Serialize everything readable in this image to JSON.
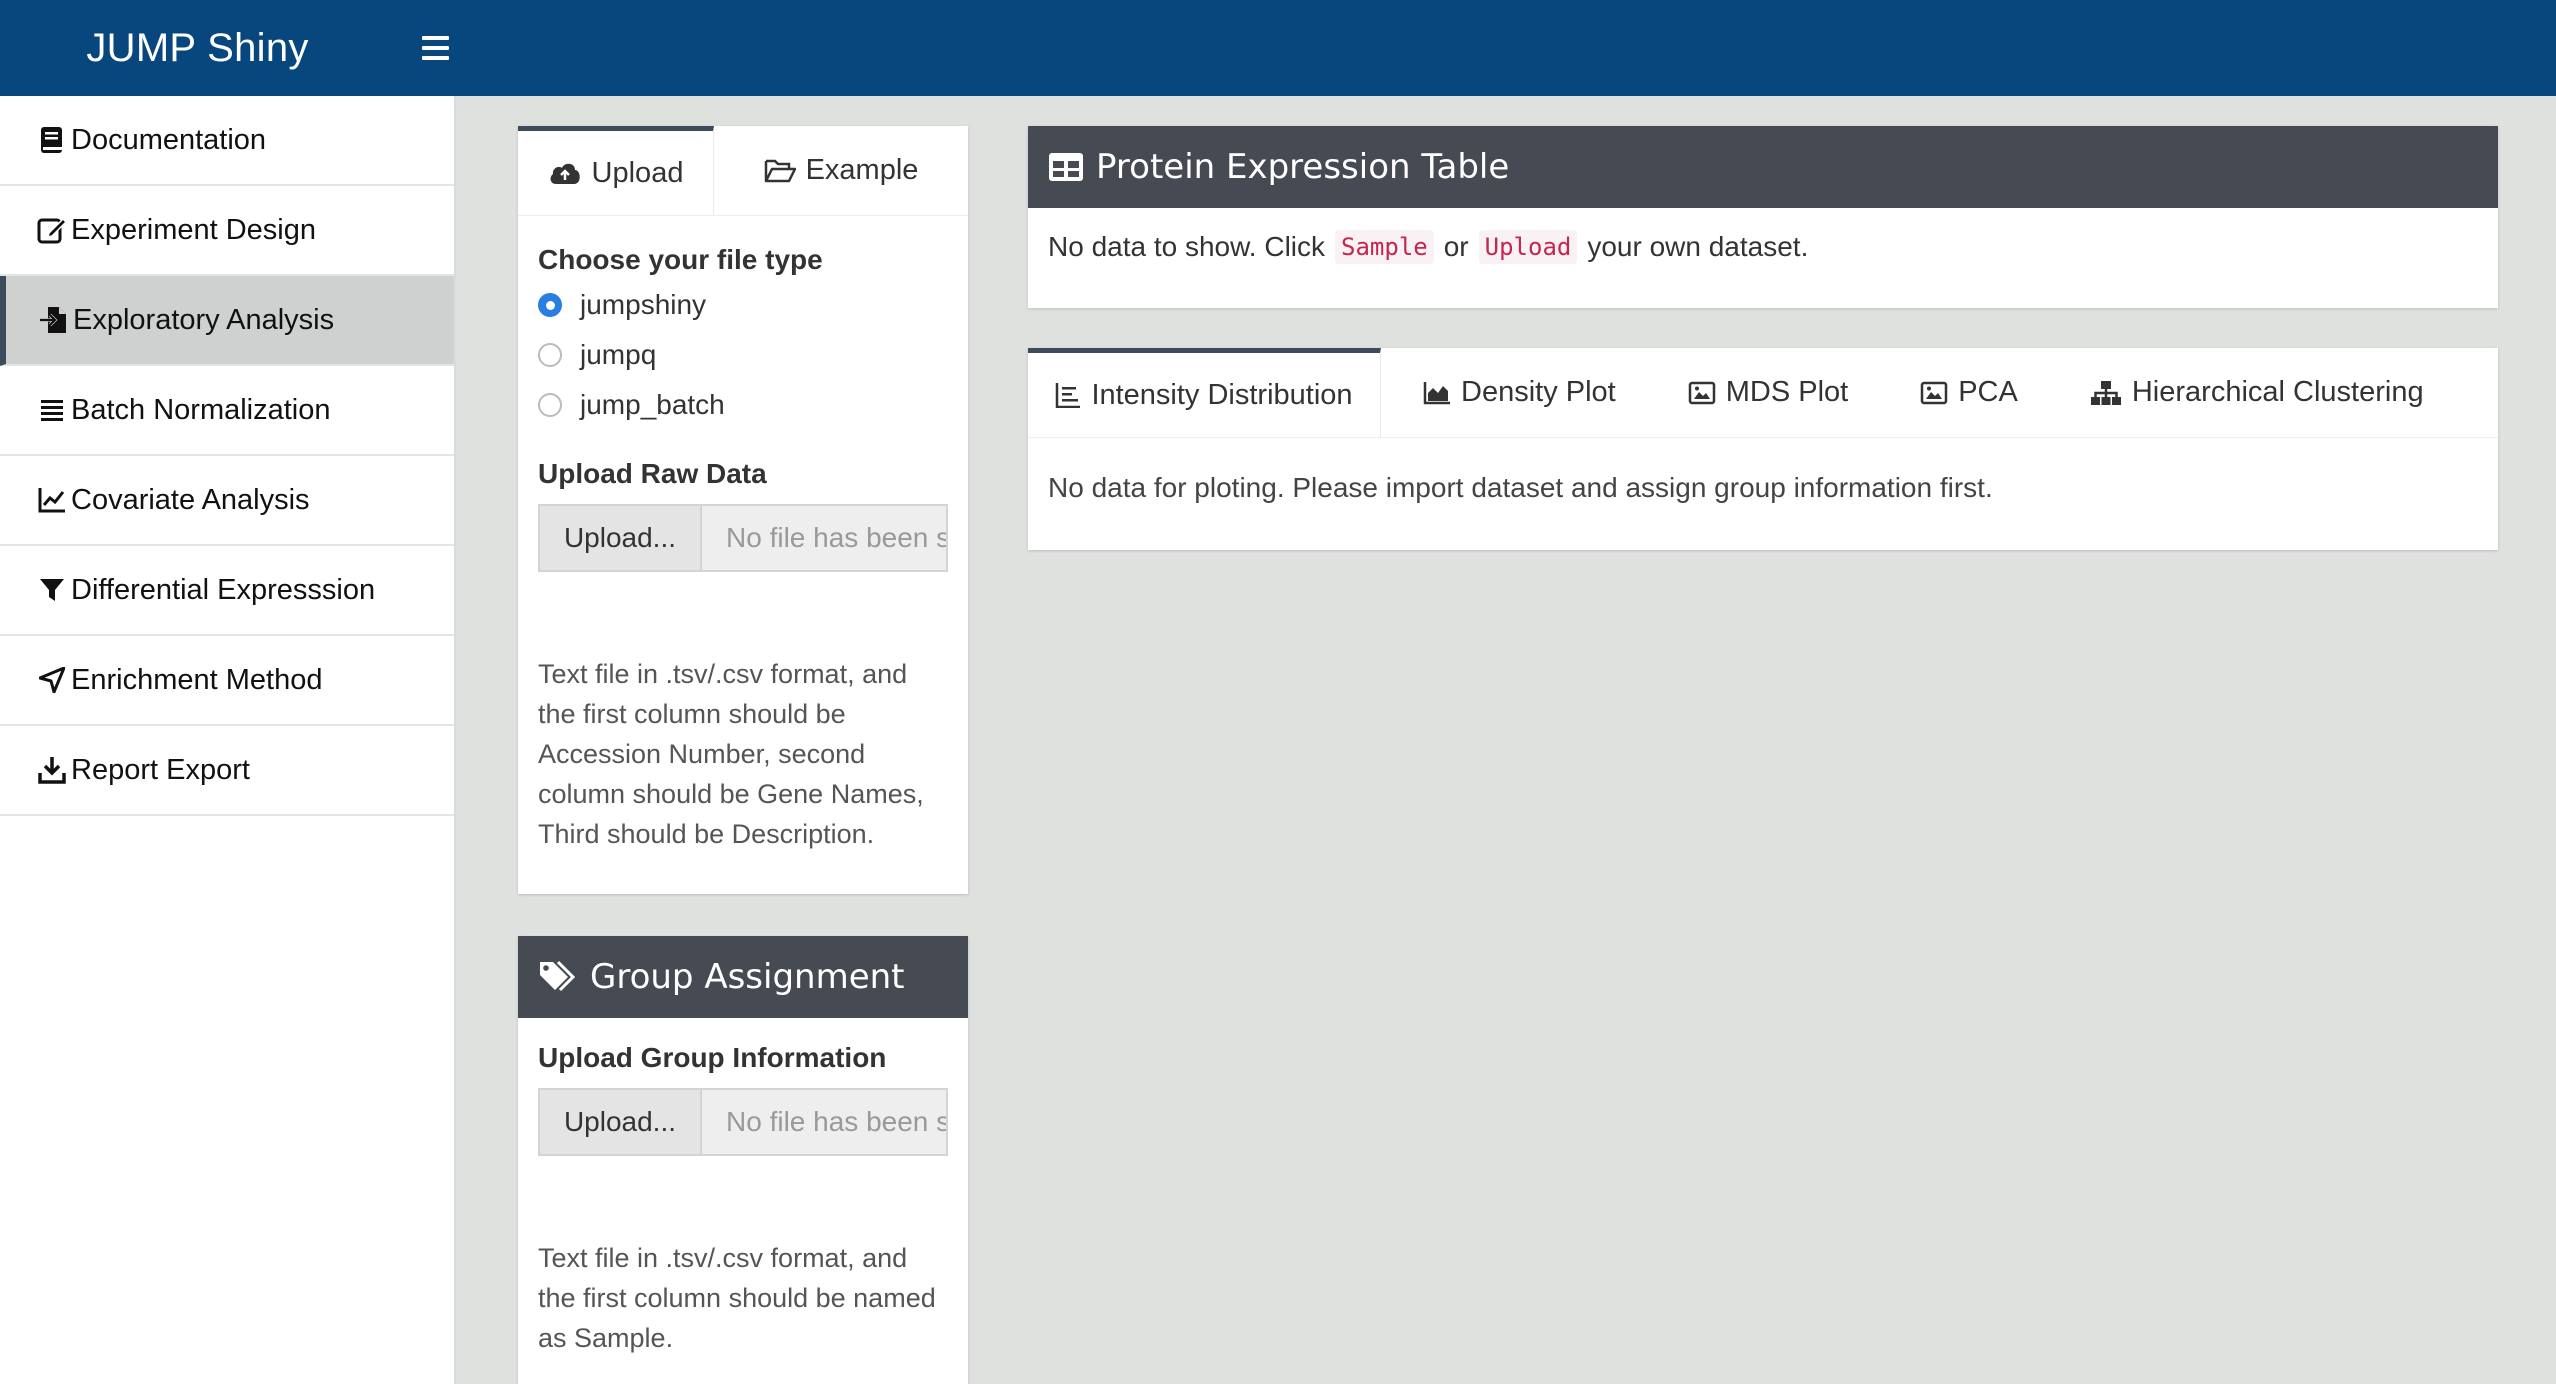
{
  "app": {
    "title": "JUMP Shiny"
  },
  "sidebar": {
    "items": [
      {
        "label": "Documentation",
        "icon": "book-icon"
      },
      {
        "label": "Experiment Design",
        "icon": "edit-icon"
      },
      {
        "label": "Exploratory Analysis",
        "icon": "file-import-icon",
        "active": true
      },
      {
        "label": "Batch Normalization",
        "icon": "list-icon"
      },
      {
        "label": "Covariate Analysis",
        "icon": "line-chart-icon"
      },
      {
        "label": "Differential Expresssion",
        "icon": "filter-icon"
      },
      {
        "label": "Enrichment Method",
        "icon": "location-arrow-icon"
      },
      {
        "label": "Report Export",
        "icon": "download-icon"
      }
    ]
  },
  "upload_panel": {
    "tabs": [
      {
        "label": "Upload",
        "icon": "cloud-upload-icon",
        "active": true
      },
      {
        "label": "Example",
        "icon": "folder-open-icon"
      }
    ],
    "file_type_label": "Choose your file type",
    "file_types": [
      "jumpshiny",
      "jumpq",
      "jump_batch"
    ],
    "selected_file_type": "jumpshiny",
    "raw_data_label": "Upload Raw Data",
    "upload_button": "Upload...",
    "file_placeholder": "No file has been selected",
    "help_text": "Text file in .tsv/.csv format, and the first column should be Accession Number, second column should be Gene Names, Third should be Description."
  },
  "group_panel": {
    "title": "Group Assignment",
    "icon": "tags-icon",
    "upload_label": "Upload Group Information",
    "upload_button": "Upload...",
    "file_placeholder": "No file has been selected",
    "help_text": "Text file in .tsv/.csv format, and the first column should be named as Sample."
  },
  "protein_panel": {
    "title": "Protein Expression Table",
    "icon": "table-icon",
    "message_prefix": "No data to show. Click",
    "sample_code": "Sample",
    "message_or": "or",
    "upload_code": "Upload",
    "message_suffix": "your own dataset."
  },
  "plot_panel": {
    "tabs": [
      {
        "label": "Intensity Distribution",
        "icon": "align-left-icon",
        "active": true
      },
      {
        "label": "Density Plot",
        "icon": "area-chart-icon"
      },
      {
        "label": "MDS Plot",
        "icon": "image-icon"
      },
      {
        "label": "PCA",
        "icon": "image-icon"
      },
      {
        "label": "Hierarchical Clustering",
        "icon": "sitemap-icon"
      }
    ],
    "message": "No data for ploting. Please import dataset and assign group information first."
  },
  "colors": {
    "header": "#08477e",
    "card_title": "#464b53",
    "content_bg": "#dfe1df",
    "radio_checked": "#2a7de1",
    "code_text": "#c7254e"
  }
}
